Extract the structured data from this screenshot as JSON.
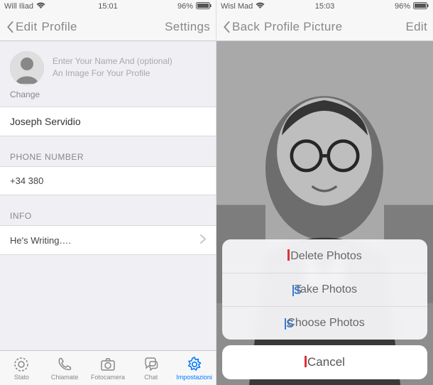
{
  "left": {
    "status": {
      "carrier": "Will Iliad",
      "time": "15:01",
      "battery": "96%"
    },
    "nav": {
      "back": "Edit",
      "title": "Profile",
      "right": "Settings"
    },
    "profile": {
      "hint_line1": "Enter Your Name And (optional)",
      "hint_line2": "An Image For Your Profile",
      "change": "Change",
      "name_value": "Joseph Servidio"
    },
    "phone": {
      "section": "PHONE NUMBER",
      "value": "+34 380"
    },
    "info": {
      "section": "INFO",
      "value": "He's Writing…."
    },
    "tabs": [
      {
        "icon": "status-icon",
        "label": "Stato"
      },
      {
        "icon": "calls-icon",
        "label": "Chiamate"
      },
      {
        "icon": "camera-icon",
        "label": "Fotocamera"
      },
      {
        "icon": "chat-icon",
        "label": "Chat"
      },
      {
        "icon": "settings-icon",
        "label": "Impostazioni"
      }
    ]
  },
  "right": {
    "status": {
      "carrier": "Wisl Mad",
      "time": "15:03",
      "battery": "96%"
    },
    "nav": {
      "back": "Back",
      "title": "Profile Picture",
      "right": "Edit"
    },
    "sheet": {
      "delete": "Delete Photos",
      "take": "Take Photos",
      "choose": "Choose Photos",
      "cancel": "Cancel"
    }
  }
}
